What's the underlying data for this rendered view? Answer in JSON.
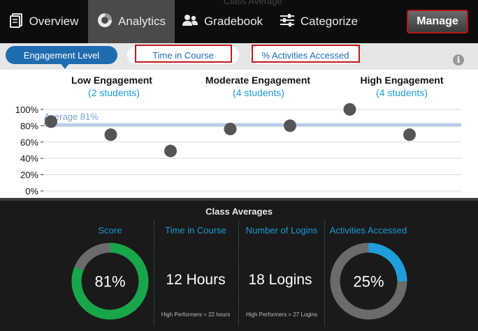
{
  "background_title": "Class Average",
  "nav": {
    "tabs": [
      {
        "label": "Overview",
        "icon": "document-icon"
      },
      {
        "label": "Analytics",
        "icon": "pie-chart-icon",
        "active": true
      },
      {
        "label": "Gradebook",
        "icon": "people-icon"
      },
      {
        "label": "Categorize",
        "icon": "sliders-icon"
      }
    ],
    "manage_label": "Manage"
  },
  "metrics": {
    "options": [
      "Engagement Level",
      "Time in Course",
      "% Activities Accessed"
    ],
    "selected": "Engagement Level",
    "info_icon": "info-icon"
  },
  "engagement": {
    "groups": [
      {
        "title": "Low Engagement",
        "subtitle": "(2 students)"
      },
      {
        "title": "Moderate Engagement",
        "subtitle": "(4 students)"
      },
      {
        "title": "High Engagement",
        "subtitle": "(4 students)"
      }
    ]
  },
  "chart_data": {
    "type": "scatter",
    "y_ticks": [
      "100%",
      "80%",
      "60%",
      "40%",
      "20%",
      "0%"
    ],
    "ylim": [
      0,
      100
    ],
    "grid": true,
    "average": {
      "label": "Average 81%",
      "value": 81
    },
    "points": [
      85,
      69,
      49,
      76,
      80,
      100,
      69
    ],
    "colors": {
      "point": "#555555",
      "average_line": "#b8cfe6",
      "grid": "#d9d9d9"
    }
  },
  "class_averages": {
    "title": "Class Averages",
    "columns": [
      {
        "header": "Score",
        "value_label": "81%",
        "percent": 81,
        "color": "#18a64a",
        "track": "#6b6b6b"
      },
      {
        "header": "Time in Course",
        "value_label": "12 Hours",
        "note": "High Performers = 22 hours"
      },
      {
        "header": "Number of Logins",
        "value_label": "18 Logins",
        "note": "High Performers = 27 Logins"
      },
      {
        "header": "Activities Accessed",
        "value_label": "25%",
        "percent": 25,
        "color": "#1e9fdc",
        "track": "#6b6b6b"
      }
    ]
  }
}
